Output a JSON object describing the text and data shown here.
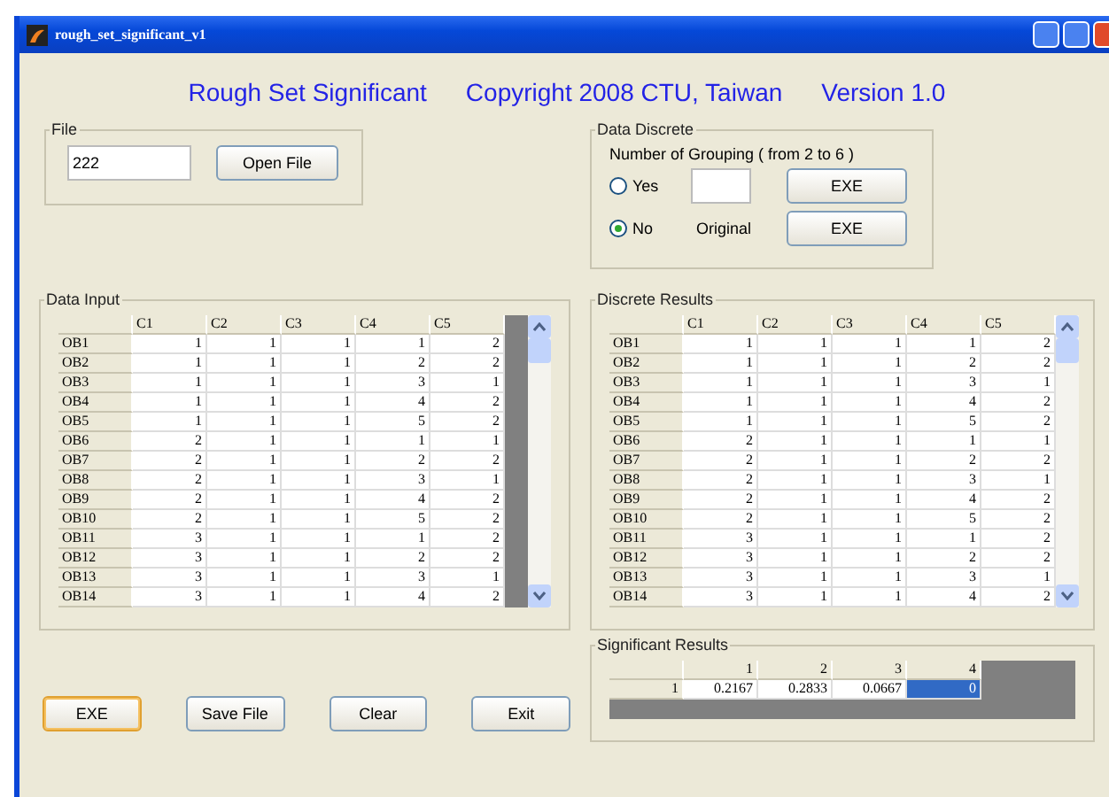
{
  "window": {
    "title": "rough_set_significant_v1"
  },
  "header": [
    "Rough Set Significant",
    "Copyright 2008 CTU, Taiwan",
    "Version 1.0"
  ],
  "file": {
    "label": "File",
    "value": "222",
    "button": "Open File"
  },
  "data_discrete": {
    "label": "Data Discrete",
    "prompt": "Number of Grouping ( from 2 to 6 )",
    "options": [
      {
        "label": "Yes",
        "selected": false
      },
      {
        "label": "No",
        "selected": true
      }
    ],
    "original_label": "Original",
    "buttons": [
      "EXE",
      "EXE"
    ]
  },
  "data_input": {
    "label": "Data Input",
    "columns": [
      "C1",
      "C2",
      "C3",
      "C4",
      "C5"
    ],
    "rows": [
      {
        "name": "OB1",
        "values": [
          "1",
          "1",
          "1",
          "1",
          "2"
        ]
      },
      {
        "name": "OB2",
        "values": [
          "1",
          "1",
          "1",
          "2",
          "2"
        ]
      },
      {
        "name": "OB3",
        "values": [
          "1",
          "1",
          "1",
          "3",
          "1"
        ]
      },
      {
        "name": "OB4",
        "values": [
          "1",
          "1",
          "1",
          "4",
          "2"
        ]
      },
      {
        "name": "OB5",
        "values": [
          "1",
          "1",
          "1",
          "5",
          "2"
        ]
      },
      {
        "name": "OB6",
        "values": [
          "2",
          "1",
          "1",
          "1",
          "1"
        ]
      },
      {
        "name": "OB7",
        "values": [
          "2",
          "1",
          "1",
          "2",
          "2"
        ]
      },
      {
        "name": "OB8",
        "values": [
          "2",
          "1",
          "1",
          "3",
          "1"
        ]
      },
      {
        "name": "OB9",
        "values": [
          "2",
          "1",
          "1",
          "4",
          "2"
        ]
      },
      {
        "name": "OB10",
        "values": [
          "2",
          "1",
          "1",
          "5",
          "2"
        ]
      },
      {
        "name": "OB11",
        "values": [
          "3",
          "1",
          "1",
          "1",
          "2"
        ]
      },
      {
        "name": "OB12",
        "values": [
          "3",
          "1",
          "1",
          "2",
          "2"
        ]
      },
      {
        "name": "OB13",
        "values": [
          "3",
          "1",
          "1",
          "3",
          "1"
        ]
      },
      {
        "name": "OB14",
        "values": [
          "3",
          "1",
          "1",
          "4",
          "2"
        ]
      }
    ]
  },
  "discrete_results": {
    "label": "Discrete Results",
    "columns": [
      "C1",
      "C2",
      "C3",
      "C4",
      "C5"
    ],
    "rows": [
      {
        "name": "OB1",
        "values": [
          "1",
          "1",
          "1",
          "1",
          "2"
        ]
      },
      {
        "name": "OB2",
        "values": [
          "1",
          "1",
          "1",
          "2",
          "2"
        ]
      },
      {
        "name": "OB3",
        "values": [
          "1",
          "1",
          "1",
          "3",
          "1"
        ]
      },
      {
        "name": "OB4",
        "values": [
          "1",
          "1",
          "1",
          "4",
          "2"
        ]
      },
      {
        "name": "OB5",
        "values": [
          "1",
          "1",
          "1",
          "5",
          "2"
        ]
      },
      {
        "name": "OB6",
        "values": [
          "2",
          "1",
          "1",
          "1",
          "1"
        ]
      },
      {
        "name": "OB7",
        "values": [
          "2",
          "1",
          "1",
          "2",
          "2"
        ]
      },
      {
        "name": "OB8",
        "values": [
          "2",
          "1",
          "1",
          "3",
          "1"
        ]
      },
      {
        "name": "OB9",
        "values": [
          "2",
          "1",
          "1",
          "4",
          "2"
        ]
      },
      {
        "name": "OB10",
        "values": [
          "2",
          "1",
          "1",
          "5",
          "2"
        ]
      },
      {
        "name": "OB11",
        "values": [
          "3",
          "1",
          "1",
          "1",
          "2"
        ]
      },
      {
        "name": "OB12",
        "values": [
          "3",
          "1",
          "1",
          "2",
          "2"
        ]
      },
      {
        "name": "OB13",
        "values": [
          "3",
          "1",
          "1",
          "3",
          "1"
        ]
      },
      {
        "name": "OB14",
        "values": [
          "3",
          "1",
          "1",
          "4",
          "2"
        ]
      }
    ]
  },
  "buttons": [
    {
      "label": "EXE",
      "focused": true
    },
    {
      "label": "Save File",
      "focused": false
    },
    {
      "label": "Clear",
      "focused": false
    },
    {
      "label": "Exit",
      "focused": false
    }
  ],
  "significant_results": {
    "label": "Significant Results",
    "columns": [
      "1",
      "2",
      "3",
      "4"
    ],
    "rows": [
      {
        "name": "1",
        "cells": [
          {
            "value": "0.2167",
            "selected": false
          },
          {
            "value": "0.2833",
            "selected": false
          },
          {
            "value": "0.0667",
            "selected": false
          },
          {
            "value": "0",
            "selected": true
          }
        ]
      }
    ]
  }
}
